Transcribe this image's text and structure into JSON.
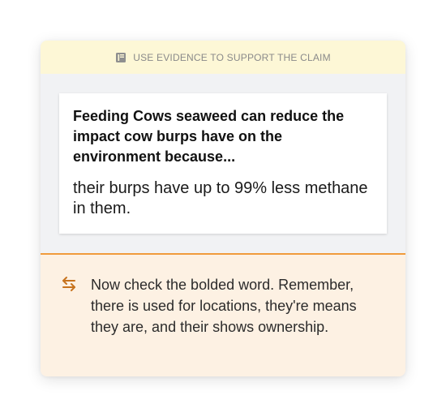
{
  "banner": {
    "icon": "book-icon",
    "text": "USE EVIDENCE TO SUPPORT THE CLAIM"
  },
  "claim": {
    "prompt": "Feeding Cows seaweed can reduce the impact cow burps have on the environment because...",
    "response": "their burps have up to 99% less methane in them."
  },
  "feedback": {
    "icon": "swap-arrows-icon",
    "text": "Now check the bolded word. Remember, there is used for locations, they're means they are, and their shows ownership."
  },
  "colors": {
    "banner_bg": "#fdf7d6",
    "feedback_bg": "#fdf1e3",
    "accent": "#f09b3c",
    "panel_bg": "#f1f2f4"
  }
}
